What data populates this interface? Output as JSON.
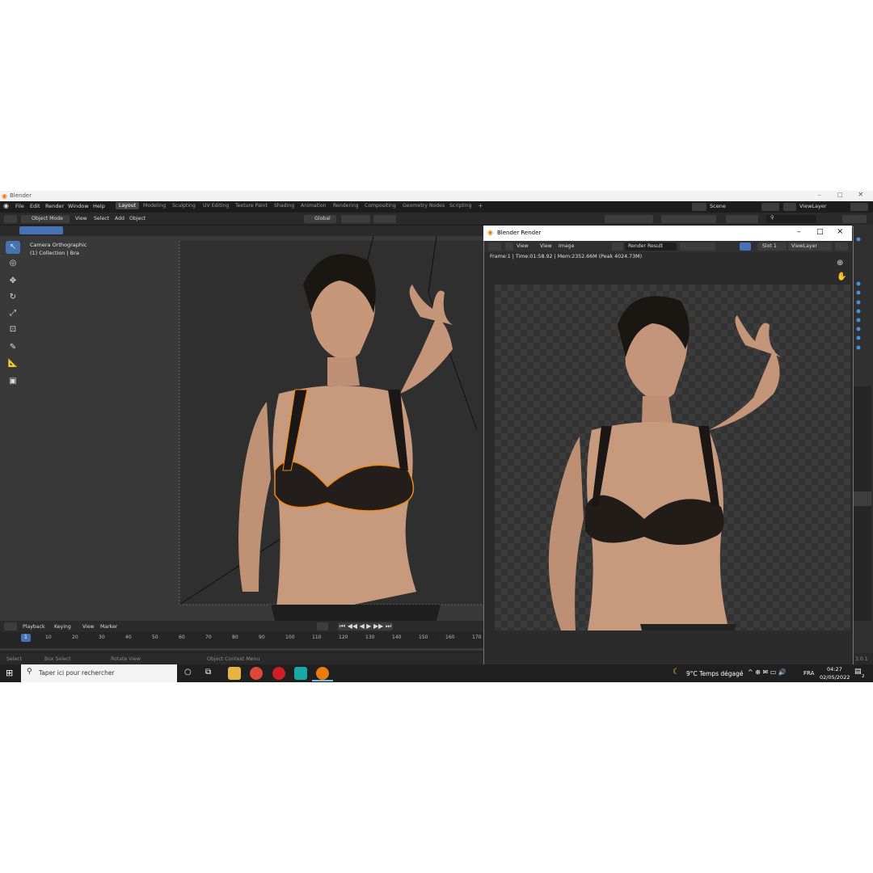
{
  "window": {
    "title": "Blender",
    "controls": [
      "–",
      "□",
      "×"
    ]
  },
  "menubar": {
    "items": [
      "File",
      "Edit",
      "Render",
      "Window",
      "Help"
    ],
    "workspaces": [
      "Layout",
      "Modeling",
      "Sculpting",
      "UV Editing",
      "Texture Paint",
      "Shading",
      "Animation",
      "Rendering",
      "Compositing",
      "Geometry Nodes",
      "Scripting"
    ],
    "active_workspace": "Layout",
    "add_tab": "+",
    "scene": "Scene",
    "view_layer": "ViewLayer"
  },
  "header": {
    "mode": "Object Mode",
    "menus": [
      "View",
      "Select",
      "Add",
      "Object"
    ],
    "orientation": "Global"
  },
  "viewport": {
    "camera_label": "Camera Orthographic",
    "collection_label": "(1) Collection | Bra"
  },
  "timeline": {
    "menus": [
      "Playback",
      "Keying",
      "View",
      "Marker"
    ],
    "current_frame": "1",
    "ticks": [
      "10",
      "20",
      "30",
      "40",
      "50",
      "60",
      "70",
      "80",
      "90",
      "100",
      "110",
      "120",
      "130",
      "140",
      "150",
      "160",
      "170"
    ]
  },
  "statusbar": {
    "items": [
      "Select",
      "Box Select",
      "Rotate View",
      "Object Context Menu"
    ],
    "version": "3.0.1"
  },
  "render_window": {
    "title": "Blender Render",
    "controls": [
      "–",
      "□",
      "×"
    ],
    "menus": [
      "View",
      "View",
      "Image"
    ],
    "image_name": "Render Result",
    "slot": "Slot 1",
    "layer": "ViewLayer",
    "info": "Frame:1 | Time:01:58.92 | Mem:2352.66M (Peak 4024.73M)"
  },
  "taskbar": {
    "search_placeholder": "Taper ici pour rechercher",
    "weather": "9°C  Temps dégagé",
    "language": "FRA",
    "time": "04:27",
    "date": "02/05/2022",
    "notifications": "2"
  }
}
